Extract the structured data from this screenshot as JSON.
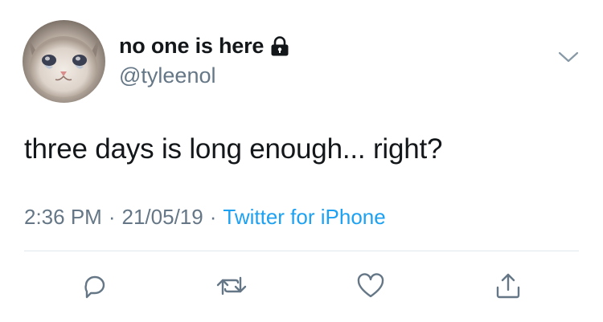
{
  "user": {
    "display_name": "no one is here",
    "handle": "@tyleenol",
    "protected": true
  },
  "tweet": {
    "text": "three days is long enough... right?",
    "time": "2:36 PM",
    "date": "21/05/19",
    "separator": "·",
    "source": "Twitter for iPhone"
  },
  "actions": [
    "reply-icon",
    "retweet-icon",
    "like-icon",
    "share-icon"
  ],
  "colors": {
    "text": "#14171a",
    "secondary": "#657786",
    "link": "#1da1f2",
    "divider": "#e1e8ed"
  }
}
